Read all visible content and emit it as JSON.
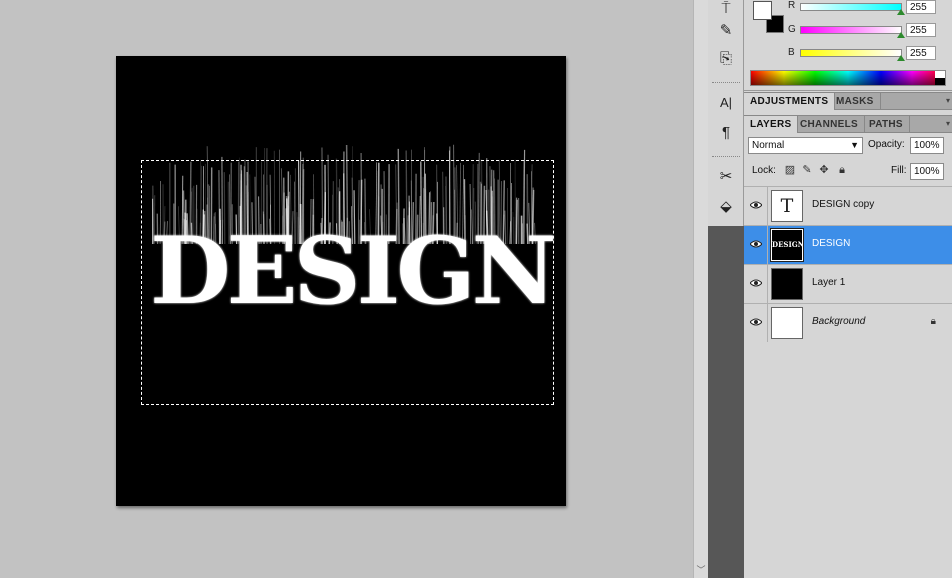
{
  "canvas": {
    "text": "DESIGN",
    "background_color": "#000000",
    "text_color": "#ffffff"
  },
  "tools": [
    {
      "name": "clone-stamp-icon",
      "glyph": "⍑"
    },
    {
      "name": "history-brush-icon",
      "glyph": "✎"
    },
    {
      "name": "eraser-stamp-icon",
      "glyph": "⎘"
    },
    {
      "name": "character-icon",
      "glyph": "A|"
    },
    {
      "name": "paragraph-icon",
      "glyph": "¶"
    },
    {
      "name": "tools-preset-icon",
      "glyph": "✂"
    },
    {
      "name": "3d-object-icon",
      "glyph": "⬙"
    }
  ],
  "color_panel": {
    "channels": [
      {
        "label": "R",
        "value": "255",
        "gradient_start": "#ffffff",
        "gradient_end": "#00ffff"
      },
      {
        "label": "G",
        "value": "255",
        "gradient_start": "#ff00ff",
        "gradient_end": "#ffffff"
      },
      {
        "label": "B",
        "value": "255",
        "gradient_start": "#ffff00",
        "gradient_end": "#ffffff"
      }
    ],
    "foreground_color": "#ffffff",
    "background_color": "#000000"
  },
  "adjustments_tabs": {
    "tabs": [
      "ADJUSTMENTS",
      "MASKS"
    ]
  },
  "layers_tabs": {
    "tabs": [
      "LAYERS",
      "CHANNELS",
      "PATHS"
    ]
  },
  "layers_panel": {
    "blend_mode": "Normal",
    "opacity_label": "Opacity:",
    "opacity_value": "100%",
    "lock_label": "Lock:",
    "fill_label": "Fill:",
    "fill_value": "100%",
    "layers": [
      {
        "name": "DESIGN copy",
        "thumb": "type",
        "selected": false,
        "italic": false,
        "locked": false
      },
      {
        "name": "DESIGN",
        "thumb": "design",
        "selected": true,
        "italic": false,
        "locked": false
      },
      {
        "name": "Layer 1",
        "thumb": "black",
        "selected": false,
        "italic": false,
        "locked": false
      },
      {
        "name": "Background",
        "thumb": "white",
        "selected": false,
        "italic": true,
        "locked": true
      }
    ],
    "selection_color": "#3d8ee8"
  }
}
